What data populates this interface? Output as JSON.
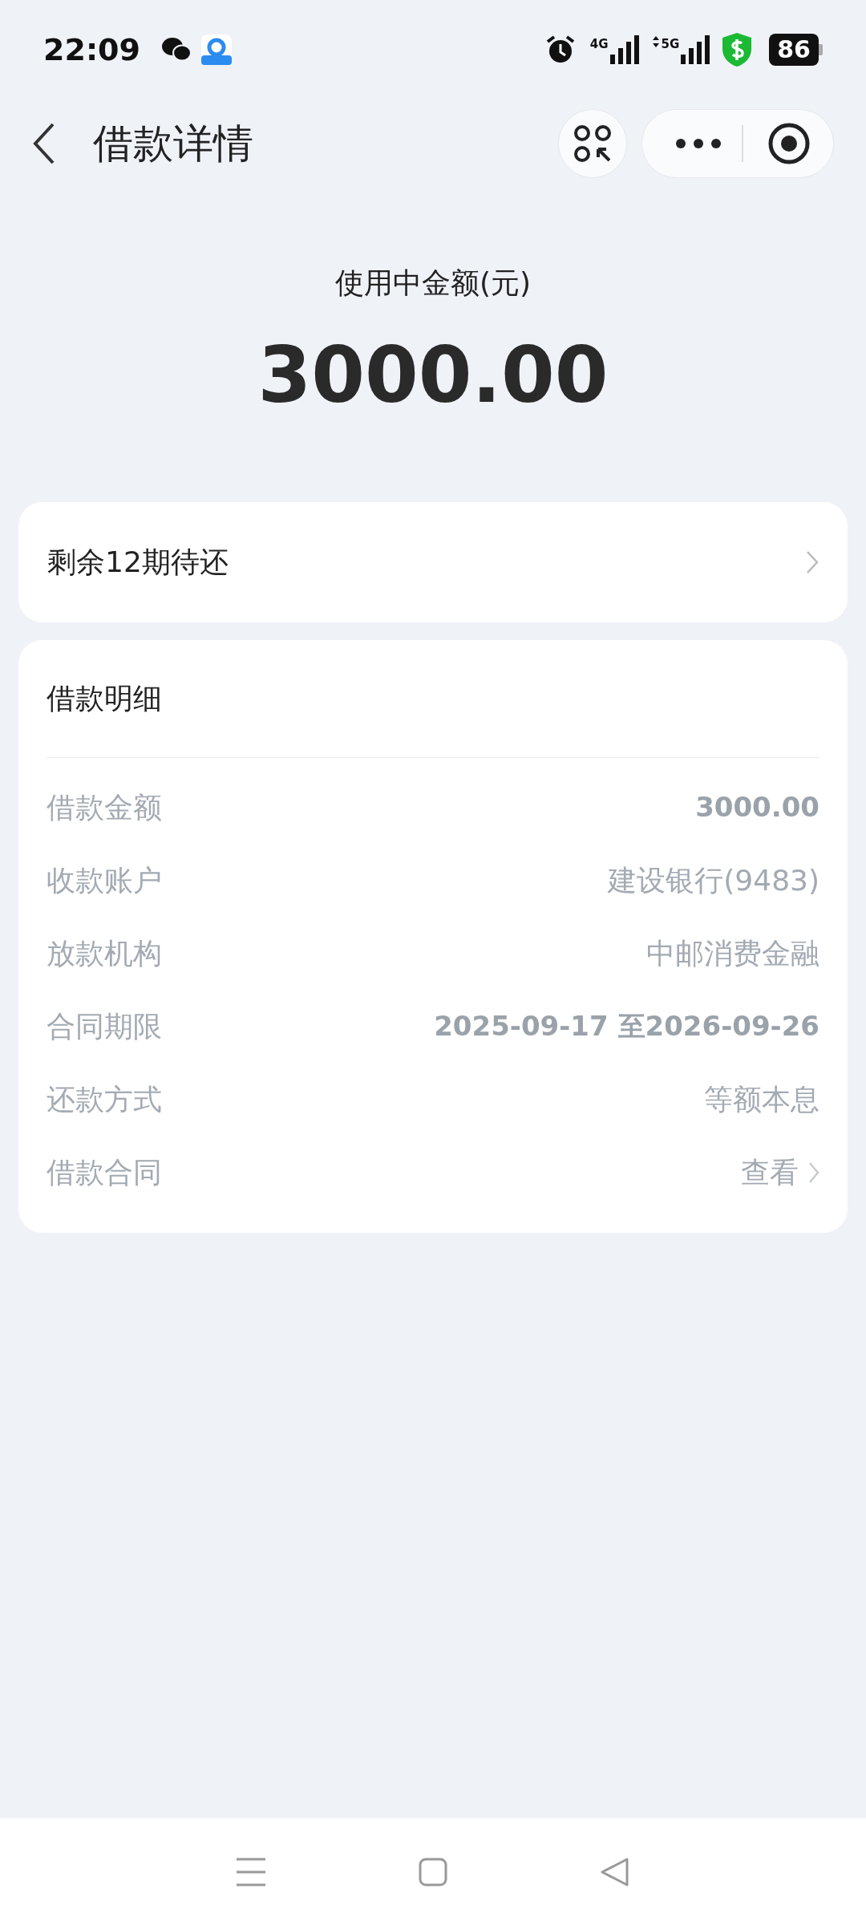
{
  "status_bar": {
    "time": "22:09",
    "network_1": "4G",
    "network_2": "5G",
    "battery": "86"
  },
  "header": {
    "title": "借款详情"
  },
  "summary": {
    "label": "使用中金额(元)",
    "amount": "3000.00"
  },
  "installments": {
    "label": "剩余12期待还"
  },
  "details": {
    "title": "借款明细",
    "rows": [
      {
        "label": "借款金额",
        "value": "3000.00",
        "kind": "number"
      },
      {
        "label": "收款账户",
        "value": "建设银行(9483)",
        "kind": "text"
      },
      {
        "label": "放款机构",
        "value": "中邮消费金融",
        "kind": "text"
      },
      {
        "label": "合同期限",
        "value": "2025-09-17 至2026-09-26",
        "kind": "number"
      },
      {
        "label": "还款方式",
        "value": "等额本息",
        "kind": "text"
      },
      {
        "label": "借款合同",
        "value": "查看",
        "kind": "link"
      }
    ]
  }
}
